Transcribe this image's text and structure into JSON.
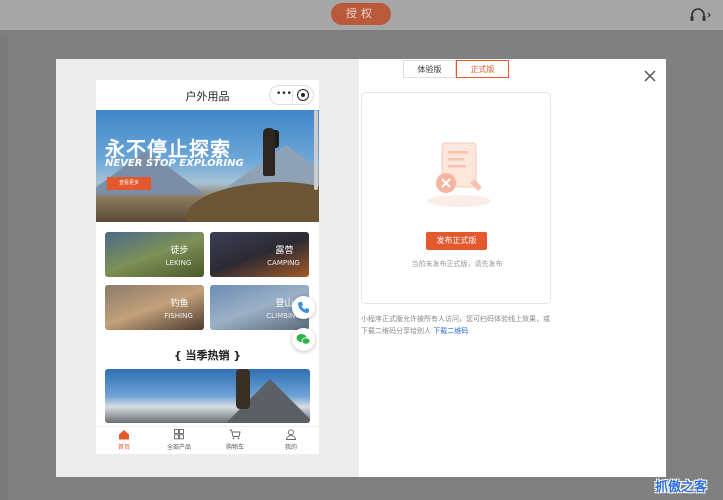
{
  "topbar": {
    "auth_label": "授权"
  },
  "phone": {
    "title": "户外用品",
    "capsule_more": "•••",
    "banner": {
      "title_cn": "永不停止探索",
      "title_en": "NEVER STOP EXPLORING",
      "button": "查看更多"
    },
    "categories": [
      {
        "cn": "徒步",
        "en": "LEKING"
      },
      {
        "cn": "露营",
        "en": "CAMPING"
      },
      {
        "cn": "钓鱼",
        "en": "FISHING"
      },
      {
        "cn": "登山",
        "en": "CLIMBING"
      }
    ],
    "section_title": "{ 当季热销 }",
    "tabs": [
      {
        "label": "首页",
        "icon": "home-icon"
      },
      {
        "label": "全部产品",
        "icon": "grid-icon"
      },
      {
        "label": "购物车",
        "icon": "cart-icon"
      },
      {
        "label": "我的",
        "icon": "user-icon"
      }
    ]
  },
  "panel": {
    "tabs": {
      "trial": "体验版",
      "production": "正式版"
    },
    "publish_button": "发布正式版",
    "hint": "当前未发布正式版，请先发布",
    "note_text": "小程序正式版允许被所有人访问，您可扫码体验线上效果，或下载二维码分享给别人",
    "note_link": "下载二维码"
  },
  "watermark": "抓傲之客",
  "colors": {
    "accent": "#e4582e",
    "link": "#2b6bd6"
  }
}
